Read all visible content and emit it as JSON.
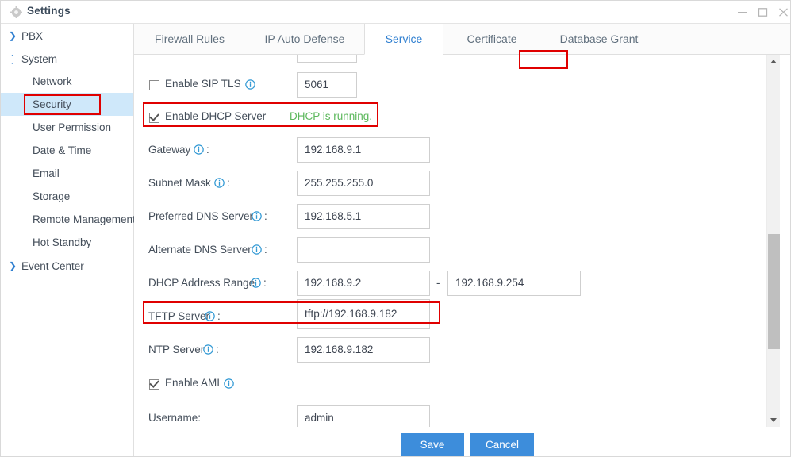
{
  "window": {
    "title": "Settings",
    "gear_icon": "gear-icon",
    "minimize_label": "Minimize",
    "maximize_label": "Maximize",
    "close_label": "Close"
  },
  "sidebar": {
    "items": [
      {
        "label": "PBX",
        "type": "group",
        "expanded": false,
        "chevron": "chevron-right-icon"
      },
      {
        "label": "System",
        "type": "group",
        "expanded": true,
        "chevron": "chevron-down-icon"
      },
      {
        "label": "Network",
        "type": "child",
        "selected": false
      },
      {
        "label": "Security",
        "type": "child",
        "selected": true
      },
      {
        "label": "User Permission",
        "type": "child",
        "selected": false
      },
      {
        "label": "Date & Time",
        "type": "child",
        "selected": false
      },
      {
        "label": "Email",
        "type": "child",
        "selected": false
      },
      {
        "label": "Storage",
        "type": "child",
        "selected": false
      },
      {
        "label": "Remote Management",
        "type": "child",
        "selected": false
      },
      {
        "label": "Hot Standby",
        "type": "child",
        "selected": false
      },
      {
        "label": "Event Center",
        "type": "group",
        "expanded": false,
        "chevron": "chevron-right-icon"
      }
    ]
  },
  "tabs": [
    {
      "label": "Firewall Rules",
      "active": false
    },
    {
      "label": "IP Auto Defense",
      "active": false
    },
    {
      "label": "Service",
      "active": true
    },
    {
      "label": "Certificate",
      "active": false
    },
    {
      "label": "Database Grant",
      "active": false
    }
  ],
  "form": {
    "sip_tls": {
      "checkbox_label": "Enable SIP TLS",
      "checked": false,
      "info_icon": "info-icon",
      "port_value": "5061"
    },
    "dhcp_server": {
      "checkbox_label": "Enable DHCP Server",
      "checked": true,
      "status_text": "DHCP is running."
    },
    "gateway": {
      "label": "Gateway",
      "suffix": ":",
      "info_icon": "info-icon",
      "value": "192.168.9.1"
    },
    "subnet_mask": {
      "label": "Subnet Mask",
      "suffix": ":",
      "info_icon": "info-icon",
      "value": "255.255.255.0"
    },
    "preferred_dns": {
      "label": "Preferred DNS Server",
      "suffix": ":",
      "info_icon": "info-icon",
      "value": "192.168.5.1"
    },
    "alternate_dns": {
      "label": "Alternate DNS Server",
      "suffix": ":",
      "info_icon": "info-icon",
      "value": ""
    },
    "dhcp_range": {
      "label": "DHCP Address Range",
      "suffix": ":",
      "info_icon": "info-icon",
      "start_value": "192.168.9.2",
      "separator": "-",
      "end_value": "192.168.9.254"
    },
    "tftp_server": {
      "label": "TFTP Server",
      "suffix": ":",
      "info_icon": "info-icon",
      "value": "tftp://192.168.9.182"
    },
    "ntp_server": {
      "label": "NTP Server",
      "suffix": ":",
      "info_icon": "info-icon",
      "value": "192.168.9.182"
    },
    "ami": {
      "checkbox_label": "Enable AMI",
      "checked": true,
      "info_icon": "info-icon"
    },
    "username": {
      "label": "Username:",
      "value": "admin"
    }
  },
  "footer": {
    "save_label": "Save",
    "cancel_label": "Cancel"
  },
  "scrollbar": {
    "up_icon": "scroll-up-arrow-icon",
    "down_icon": "scroll-down-arrow-icon"
  },
  "annotations": {
    "highlight_color": "#e00000",
    "accent_color": "#2f7fd0",
    "status_color": "#5cb85c"
  }
}
